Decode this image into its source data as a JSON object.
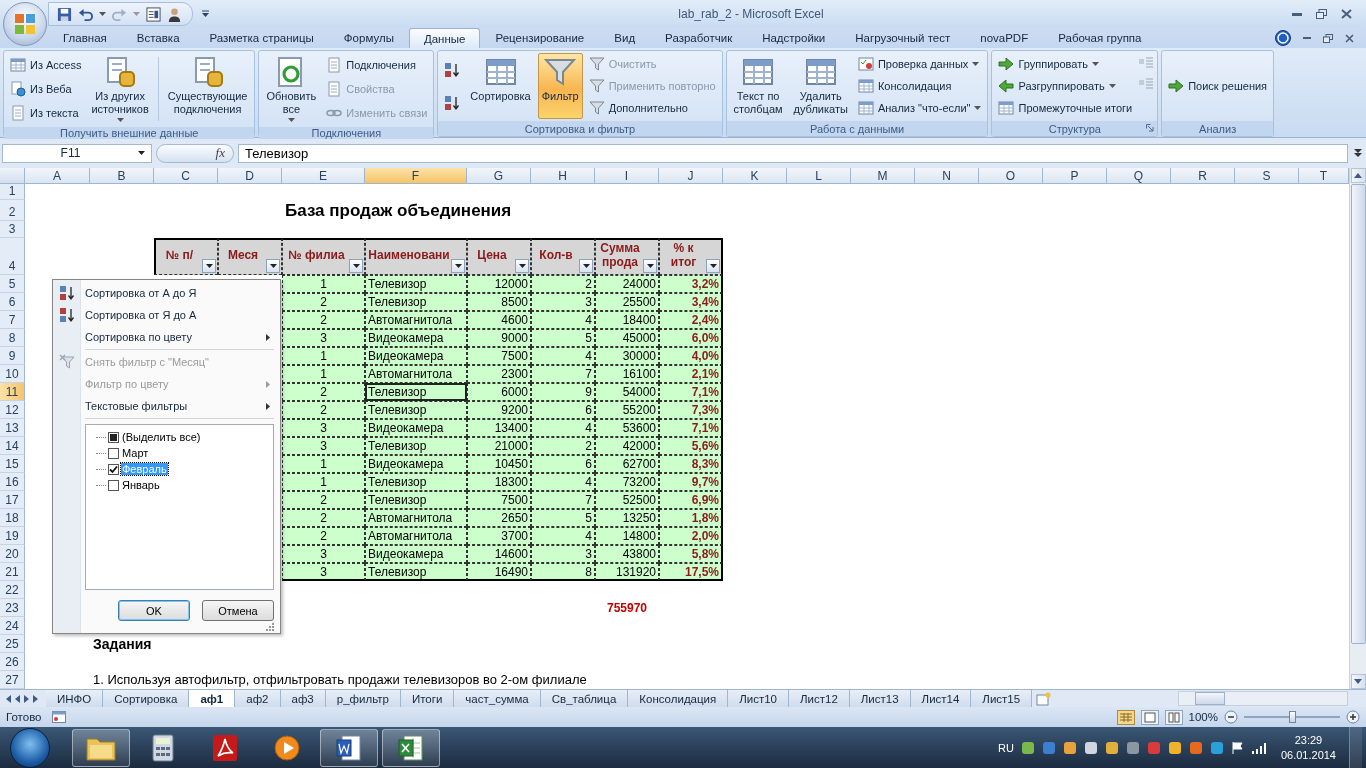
{
  "window": {
    "title": "lab_rab_2 - Microsoft Excel"
  },
  "ribbon_tabs": [
    {
      "label": "Главная",
      "selected": false
    },
    {
      "label": "Вставка",
      "selected": false
    },
    {
      "label": "Разметка страницы",
      "selected": false
    },
    {
      "label": "Формулы",
      "selected": false
    },
    {
      "label": "Данные",
      "selected": true
    },
    {
      "label": "Рецензирование",
      "selected": false
    },
    {
      "label": "Вид",
      "selected": false
    },
    {
      "label": "Разработчик",
      "selected": false
    },
    {
      "label": "Надстройки",
      "selected": false
    },
    {
      "label": "Нагрузочный тест",
      "selected": false
    },
    {
      "label": "novaPDF",
      "selected": false
    },
    {
      "label": "Рабочая группа",
      "selected": false
    }
  ],
  "ribbon_groups": [
    {
      "title": "Получить внешние данные",
      "launcher": false,
      "commands": [
        {
          "kind": "stack",
          "items": [
            {
              "label": "Из Access",
              "disabled": false,
              "dropdown": false
            },
            {
              "label": "Из Веба",
              "disabled": false,
              "dropdown": false
            },
            {
              "label": "Из текста",
              "disabled": false,
              "dropdown": false
            }
          ]
        },
        {
          "kind": "large",
          "label": "Из других\nисточников",
          "dropdown": true,
          "active": false
        },
        {
          "kind": "large",
          "label": "Существующие\nподключения",
          "dropdown": false,
          "active": false
        }
      ]
    },
    {
      "title": "Подключения",
      "launcher": false,
      "commands": [
        {
          "kind": "large",
          "label": "Обновить\nвсе",
          "dropdown": true,
          "active": false
        },
        {
          "kind": "stack",
          "items": [
            {
              "label": "Подключения",
              "disabled": false,
              "dropdown": false
            },
            {
              "label": "Свойства",
              "disabled": true,
              "dropdown": false
            },
            {
              "label": "Изменить связи",
              "disabled": true,
              "dropdown": false
            }
          ]
        }
      ]
    },
    {
      "title": "Сортировка и фильтр",
      "launcher": false,
      "commands": [
        {
          "kind": "sort_buttons"
        },
        {
          "kind": "large",
          "label": "Сортировка",
          "dropdown": false,
          "active": false
        },
        {
          "kind": "large",
          "label": "Фильтр",
          "dropdown": false,
          "active": true
        },
        {
          "kind": "stack",
          "items": [
            {
              "label": "Очистить",
              "disabled": true,
              "dropdown": false
            },
            {
              "label": "Применить повторно",
              "disabled": true,
              "dropdown": false
            },
            {
              "label": "Дополнительно",
              "disabled": false,
              "dropdown": false
            }
          ]
        }
      ]
    },
    {
      "title": "Работа с данными",
      "launcher": false,
      "commands": [
        {
          "kind": "large",
          "label": "Текст по\nстолбцам",
          "dropdown": false,
          "active": false
        },
        {
          "kind": "large",
          "label": "Удалить\nдубликаты",
          "dropdown": false,
          "active": false
        },
        {
          "kind": "stack",
          "items": [
            {
              "label": "Проверка данных",
              "disabled": false,
              "dropdown": true
            },
            {
              "label": "Консолидация",
              "disabled": false,
              "dropdown": false
            },
            {
              "label": "Анализ \"что-если\"",
              "disabled": false,
              "dropdown": true
            }
          ]
        }
      ]
    },
    {
      "title": "Структура",
      "launcher": true,
      "commands": [
        {
          "kind": "stack",
          "items": [
            {
              "label": "Группировать",
              "disabled": false,
              "dropdown": true
            },
            {
              "label": "Разгруппировать",
              "disabled": false,
              "dropdown": true
            },
            {
              "label": "Промежуточные итоги",
              "disabled": false,
              "dropdown": false
            }
          ]
        },
        {
          "kind": "outline_buttons"
        }
      ]
    },
    {
      "title": "Анализ",
      "launcher": false,
      "commands": [
        {
          "kind": "stack",
          "items": [
            {
              "label": "Поиск решения",
              "disabled": false,
              "dropdown": false
            }
          ]
        }
      ]
    }
  ],
  "formula_bar": {
    "name_box": "F11",
    "function_label": "fx",
    "value": "Телевизор"
  },
  "column_headers": [
    {
      "label": "A",
      "selected": false
    },
    {
      "label": "B",
      "selected": false
    },
    {
      "label": "C",
      "selected": false
    },
    {
      "label": "D",
      "selected": false
    },
    {
      "label": "E",
      "selected": false
    },
    {
      "label": "F",
      "selected": true
    },
    {
      "label": "G",
      "selected": false
    },
    {
      "label": "H",
      "selected": false
    },
    {
      "label": "I",
      "selected": false
    },
    {
      "label": "J",
      "selected": false
    },
    {
      "label": "K",
      "selected": false
    },
    {
      "label": "L",
      "selected": false
    },
    {
      "label": "M",
      "selected": false
    },
    {
      "label": "N",
      "selected": false
    },
    {
      "label": "O",
      "selected": false
    },
    {
      "label": "P",
      "selected": false
    },
    {
      "label": "Q",
      "selected": false
    },
    {
      "label": "R",
      "selected": false
    },
    {
      "label": "S",
      "selected": false
    },
    {
      "label": "T",
      "selected": false
    }
  ],
  "row_headers": [
    {
      "label": "1",
      "selected": false
    },
    {
      "label": "2",
      "selected": false
    },
    {
      "label": "3",
      "selected": false
    },
    {
      "label": "4",
      "selected": false
    },
    {
      "label": "5",
      "selected": false
    },
    {
      "label": "6",
      "selected": false
    },
    {
      "label": "7",
      "selected": false
    },
    {
      "label": "8",
      "selected": false
    },
    {
      "label": "9",
      "selected": false
    },
    {
      "label": "10",
      "selected": false
    },
    {
      "label": "11",
      "selected": true
    },
    {
      "label": "12",
      "selected": false
    },
    {
      "label": "13",
      "selected": false
    },
    {
      "label": "14",
      "selected": false
    },
    {
      "label": "15",
      "selected": false
    },
    {
      "label": "16",
      "selected": false
    },
    {
      "label": "17",
      "selected": false
    },
    {
      "label": "18",
      "selected": false
    },
    {
      "label": "19",
      "selected": false
    },
    {
      "label": "20",
      "selected": false
    },
    {
      "label": "21",
      "selected": false
    },
    {
      "label": "22",
      "selected": false
    },
    {
      "label": "23",
      "selected": false
    },
    {
      "label": "24",
      "selected": false
    },
    {
      "label": "25",
      "selected": false
    },
    {
      "label": "26",
      "selected": false
    },
    {
      "label": "27",
      "selected": false
    }
  ],
  "sheet_title": "База продаж объединения",
  "table": {
    "columns": [
      "№ п/",
      "Меся",
      "№ филиа",
      "Наименовани",
      "Цена",
      "Кол-в",
      "Сумма\nпрода",
      "% к\nитог"
    ],
    "rows": [
      {
        "branch": "1",
        "product": "Телевизор",
        "price": "12000",
        "quantity": "2",
        "sum": "24000",
        "share": "3,2%",
        "selected": false
      },
      {
        "branch": "2",
        "product": "Телевизор",
        "price": "8500",
        "quantity": "3",
        "sum": "25500",
        "share": "3,4%",
        "selected": false
      },
      {
        "branch": "2",
        "product": "Автомагнитола",
        "price": "4600",
        "quantity": "4",
        "sum": "18400",
        "share": "2,4%",
        "selected": false
      },
      {
        "branch": "3",
        "product": "Видеокамера",
        "price": "9000",
        "quantity": "5",
        "sum": "45000",
        "share": "6,0%",
        "selected": false
      },
      {
        "branch": "1",
        "product": "Видеокамера",
        "price": "7500",
        "quantity": "4",
        "sum": "30000",
        "share": "4,0%",
        "selected": false
      },
      {
        "branch": "1",
        "product": "Автомагнитола",
        "price": "2300",
        "quantity": "7",
        "sum": "16100",
        "share": "2,1%",
        "selected": false
      },
      {
        "branch": "2",
        "product": "Телевизор",
        "price": "6000",
        "quantity": "9",
        "sum": "54000",
        "share": "7,1%",
        "selected": true
      },
      {
        "branch": "2",
        "product": "Телевизор",
        "price": "9200",
        "quantity": "6",
        "sum": "55200",
        "share": "7,3%",
        "selected": false
      },
      {
        "branch": "3",
        "product": "Видеокамера",
        "price": "13400",
        "quantity": "4",
        "sum": "53600",
        "share": "7,1%",
        "selected": false
      },
      {
        "branch": "3",
        "product": "Телевизор",
        "price": "21000",
        "quantity": "2",
        "sum": "42000",
        "share": "5,6%",
        "selected": false
      },
      {
        "branch": "1",
        "product": "Видеокамера",
        "price": "10450",
        "quantity": "6",
        "sum": "62700",
        "share": "8,3%",
        "selected": false
      },
      {
        "branch": "1",
        "product": "Телевизор",
        "price": "18300",
        "quantity": "4",
        "sum": "73200",
        "share": "9,7%",
        "selected": false
      },
      {
        "branch": "2",
        "product": "Телевизор",
        "price": "7500",
        "quantity": "7",
        "sum": "52500",
        "share": "6,9%",
        "selected": false
      },
      {
        "branch": "2",
        "product": "Автомагнитола",
        "price": "2650",
        "quantity": "5",
        "sum": "13250",
        "share": "1,8%",
        "selected": false
      },
      {
        "branch": "2",
        "product": "Автомагнитола",
        "price": "3700",
        "quantity": "4",
        "sum": "14800",
        "share": "2,0%",
        "selected": false
      },
      {
        "branch": "3",
        "product": "Видеокамера",
        "price": "14600",
        "quantity": "3",
        "sum": "43800",
        "share": "5,8%",
        "selected": false
      },
      {
        "branch": "3",
        "product": "Телевизор",
        "price": "16490",
        "quantity": "8",
        "sum": "131920",
        "share": "17,5%",
        "selected": false
      }
    ],
    "total": "755970"
  },
  "tasks_heading": "Задания",
  "task_text": "1. Используя автофильтр, отфильтровать продажи телевизоров во 2-ом филиале",
  "filter_menu": {
    "sections": [
      [
        {
          "label": "Сортировка от А до Я",
          "kind": "sort_asc",
          "disabled": false,
          "submenu": false
        },
        {
          "label": "Сортировка от Я до А",
          "kind": "sort_desc",
          "disabled": false,
          "submenu": false
        },
        {
          "label": "Сортировка по цвету",
          "kind": "plain",
          "disabled": false,
          "submenu": true
        }
      ],
      [
        {
          "label": "Снять фильтр с \"Месяц\"",
          "kind": "clear_filter",
          "disabled": true,
          "submenu": false
        },
        {
          "label": "Фильтр по цвету",
          "kind": "plain",
          "disabled": true,
          "submenu": true
        },
        {
          "label": "Текстовые фильтры",
          "kind": "plain",
          "disabled": false,
          "submenu": true
        }
      ]
    ],
    "values": [
      {
        "label": "(Выделить все)",
        "checked": false,
        "partial": true,
        "selected": false
      },
      {
        "label": "Март",
        "checked": false,
        "selected": false
      },
      {
        "label": "Февраль",
        "checked": true,
        "selected": true
      },
      {
        "label": "Январь",
        "checked": false,
        "selected": false
      }
    ],
    "buttons": [
      {
        "label": "OK",
        "default": true
      },
      {
        "label": "Отмена",
        "default": false
      }
    ]
  },
  "sheet_tabs": [
    {
      "label": "ИНФО",
      "selected": false
    },
    {
      "label": "Сортировка",
      "selected": false
    },
    {
      "label": "аф1",
      "selected": true
    },
    {
      "label": "аф2",
      "selected": false
    },
    {
      "label": "аф3",
      "selected": false
    },
    {
      "label": "р_фильтр",
      "selected": false
    },
    {
      "label": "Итоги",
      "selected": false
    },
    {
      "label": "част_сумма",
      "selected": false
    },
    {
      "label": "Св_таблица",
      "selected": false
    },
    {
      "label": "Консолидация",
      "selected": false
    },
    {
      "label": "Лист10",
      "selected": false
    },
    {
      "label": "Лист12",
      "selected": false
    },
    {
      "label": "Лист13",
      "selected": false
    },
    {
      "label": "Лист14",
      "selected": false
    },
    {
      "label": "Лист15",
      "selected": false
    }
  ],
  "status_bar": {
    "status": "Готово",
    "zoom": "100%",
    "zoom_slider": {
      "level": 0.5
    }
  },
  "taskbar": {
    "apps": [
      {
        "kind": "folder",
        "running": true
      },
      {
        "kind": "calculator",
        "running": false
      },
      {
        "kind": "pdf",
        "running": false
      },
      {
        "kind": "player",
        "running": false
      },
      {
        "kind": "word",
        "running": true
      },
      {
        "kind": "excel",
        "running": true
      }
    ],
    "language": "RU",
    "time": "23:29",
    "date": "06.01.2014"
  }
}
